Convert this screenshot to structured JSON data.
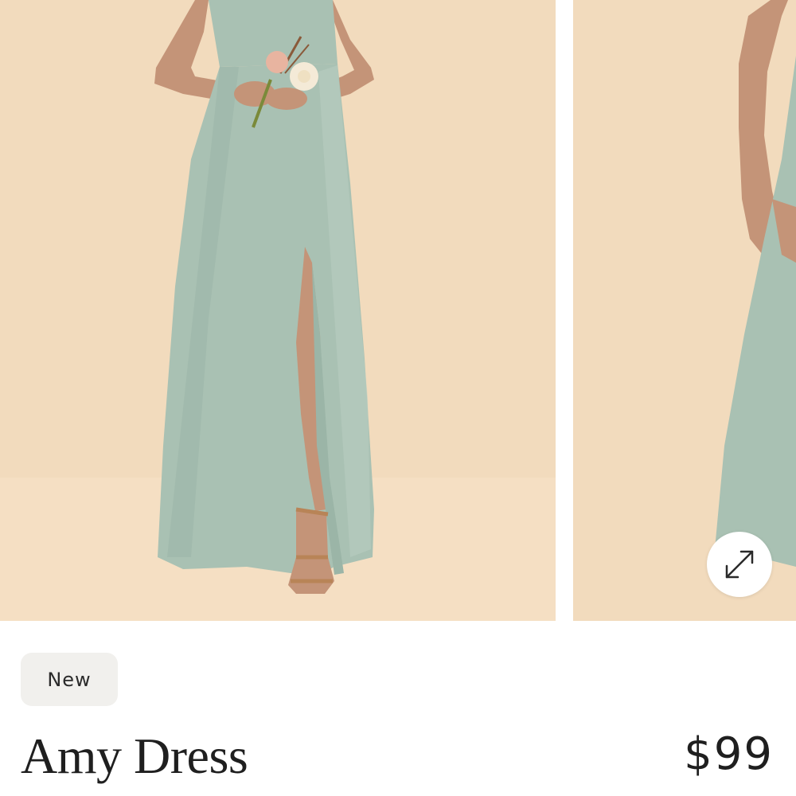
{
  "gallery": {
    "background_color": "#f2dbbd",
    "dress_color": "#a9c1b3",
    "skin_color": "#c49478",
    "images": [
      {
        "name": "product-photo-front"
      },
      {
        "name": "product-photo-back"
      }
    ],
    "expand_icon": "expand-arrows-icon"
  },
  "product": {
    "badge": "New",
    "name": "Amy Dress",
    "price": "$99"
  }
}
